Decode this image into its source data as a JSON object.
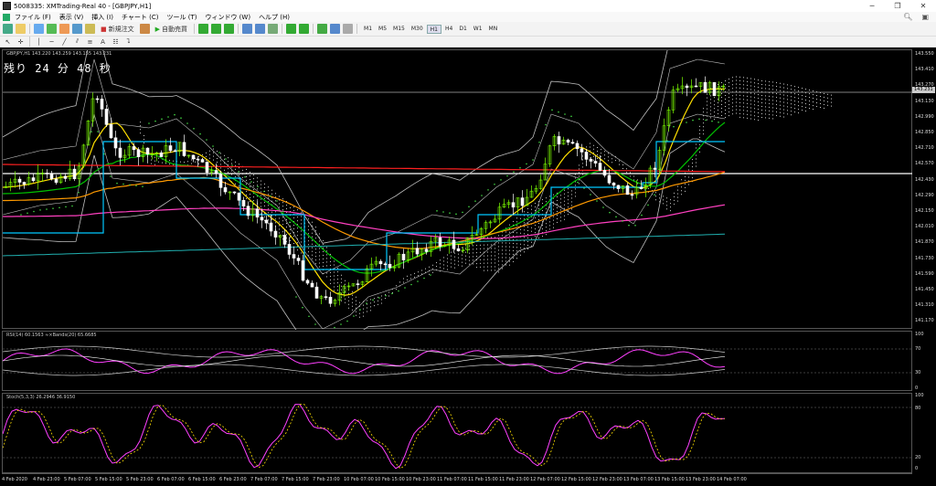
{
  "window": {
    "title": "5008335: XMTrading-Real 40 - [GBPJPY,H1]",
    "controls": [
      "─",
      "❐",
      "✕"
    ]
  },
  "menu": {
    "items": [
      "ファイル (F)",
      "表示 (V)",
      "挿入 (I)",
      "チャート (C)",
      "ツール (T)",
      "ウィンドウ (W)",
      "ヘルプ (H)"
    ]
  },
  "toolbar": {
    "new_order": "新規注文",
    "auto_trading": "自動売買",
    "timeframes": [
      "M1",
      "M5",
      "M15",
      "M30",
      "H1",
      "H4",
      "D1",
      "W1",
      "MN"
    ],
    "active_timeframe": "H1"
  },
  "chart": {
    "symbol_line": "GBPJPY,H1  143.220 143.259 143.155 143.231",
    "countdown": "残り 24 分 48 秒",
    "current_price": "143.231",
    "price_ticks": [
      "143.550",
      "143.410",
      "143.270",
      "143.130",
      "142.990",
      "142.850",
      "142.710",
      "142.570",
      "142.430",
      "142.290",
      "142.150",
      "142.010",
      "141.870",
      "141.730",
      "141.590",
      "141.450",
      "141.310",
      "141.170"
    ],
    "rsi_label": "RSI(14) 60.1563  ≈×Bands(20) 65.6685",
    "rsi_ticks": [
      "100",
      "70",
      "30",
      "0"
    ],
    "stoch_label": "Stoch(5,3,3) 26.2946 36.9150",
    "stoch_ticks": [
      "100",
      "80",
      "20",
      "0"
    ],
    "time_labels": [
      "4 Feb 2020",
      "4 Feb 23:00",
      "5 Feb 07:00",
      "5 Feb 15:00",
      "5 Feb 23:00",
      "6 Feb 07:00",
      "6 Feb 15:00",
      "6 Feb 23:00",
      "7 Feb 07:00",
      "7 Feb 15:00",
      "7 Feb 23:00",
      "10 Feb 07:00",
      "10 Feb 15:00",
      "10 Feb 23:00",
      "11 Feb 07:00",
      "11 Feb 15:00",
      "11 Feb 23:00",
      "12 Feb 07:00",
      "12 Feb 15:00",
      "12 Feb 23:00",
      "13 Feb 07:00",
      "13 Feb 15:00",
      "13 Feb 23:00",
      "14 Feb 07:00"
    ],
    "colors": {
      "background": "#000000",
      "bull_candle": "#7cfc00",
      "bear_candle": "#ffffff",
      "ma_red": "#ff2020",
      "ma_yellow": "#ffe000",
      "ma_orange": "#ff9a00",
      "ma_green": "#00c000",
      "ma_cyan": "#00c8ff",
      "ma_pink": "#ff40c0",
      "bands": "#c0c0c0",
      "rsi_line": "#ff40ff",
      "stoch_main": "#ff40ff",
      "stoch_signal": "#ffe000"
    }
  }
}
